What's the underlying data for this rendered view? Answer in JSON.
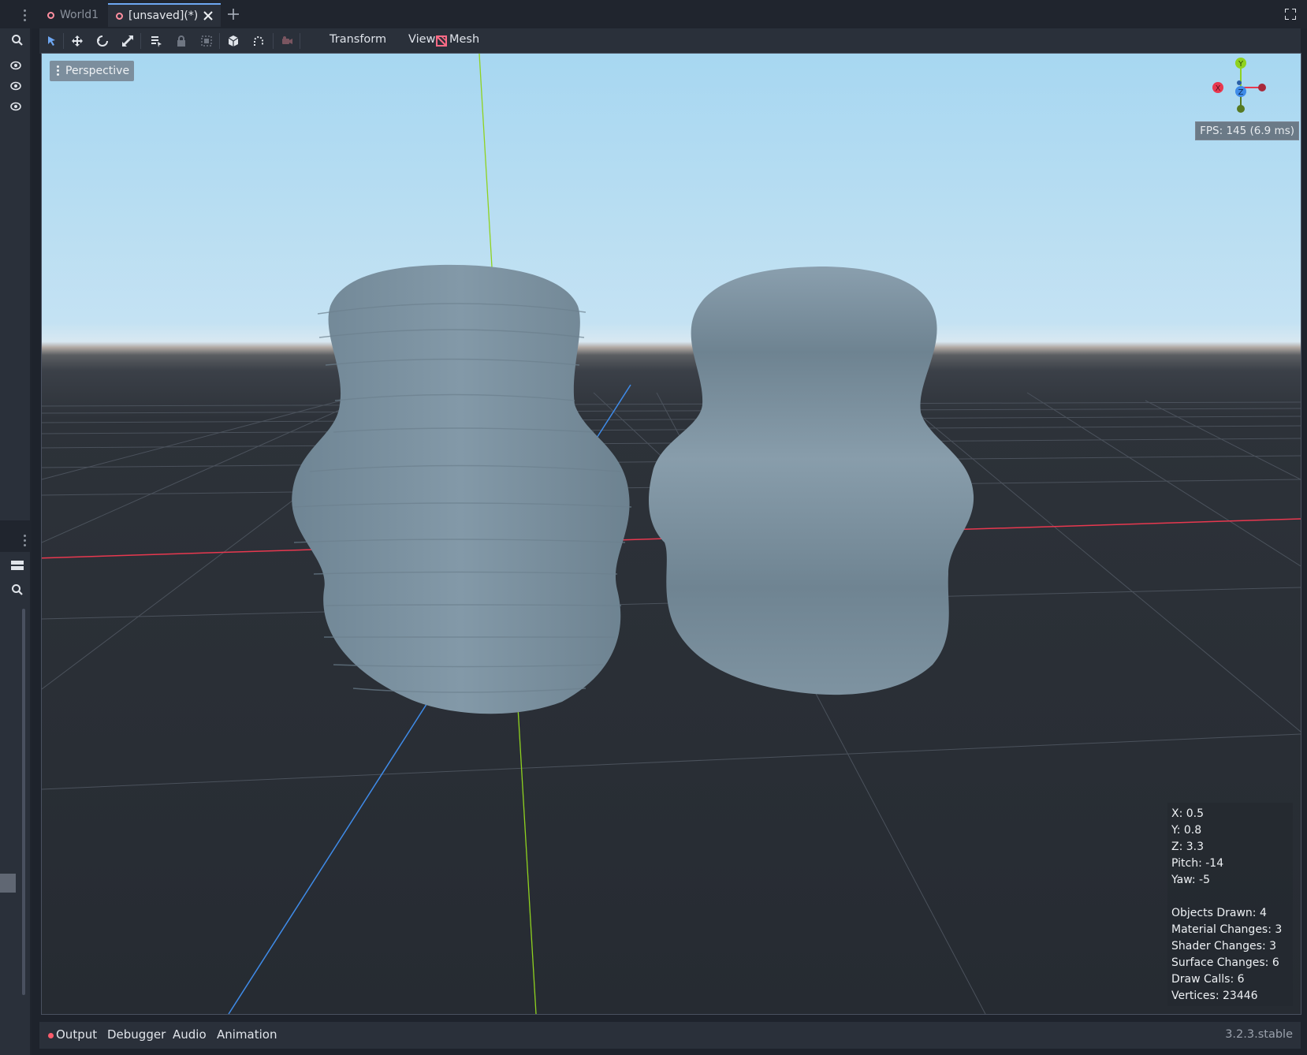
{
  "tabs": [
    {
      "label": "World1",
      "active": false
    },
    {
      "label": "[unsaved](*)",
      "active": true
    }
  ],
  "toolbar": {
    "menus": [
      "Transform",
      "View",
      "Mesh"
    ],
    "icons": [
      "select-tool-icon",
      "move-tool-icon",
      "rotate-tool-icon",
      "scale-tool-icon",
      "list-select-icon",
      "lock-icon",
      "group-icon",
      "local-space-icon",
      "snap-icon",
      "camera-override-icon",
      "mesh-icon"
    ]
  },
  "viewport": {
    "view_label": "Perspective",
    "fps": "FPS: 145 (6.9 ms)",
    "gizmo": {
      "x": "X",
      "y": "Y",
      "z": "Z"
    },
    "stats": {
      "x": "X: 0.5",
      "y": "Y: 0.8",
      "z": "Z: 3.3",
      "pitch": "Pitch: -14",
      "yaw": "Yaw: -5",
      "objects_drawn": "Objects Drawn: 4",
      "material_changes": "Material Changes: 3",
      "shader_changes": "Shader Changes: 3",
      "surface_changes": "Surface Changes: 6",
      "draw_calls": "Draw Calls: 6",
      "vertices": "Vertices: 23446"
    }
  },
  "bottom_panel": {
    "tabs": [
      "Output",
      "Debugger",
      "Audio",
      "Animation"
    ],
    "version": "3.2.3.stable"
  },
  "colors": {
    "accent": "#6ea7f2",
    "x_axis": "#e8384f",
    "y_axis": "#8fd21f",
    "z_axis": "#3f8be8",
    "mesh": "#7d93a3",
    "unsaved_ring": "#ff8fa0"
  }
}
